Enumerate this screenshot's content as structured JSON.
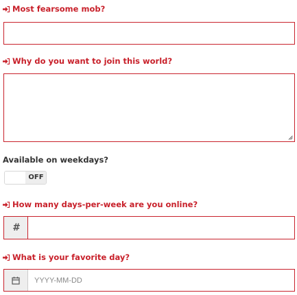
{
  "form": {
    "mob_label": "Most fearsome mob?",
    "why_label": "Why do you want to join this world?",
    "weekdays_label": "Available on weekdays?",
    "weekdays_toggle": "OFF",
    "days_label": "How many days-per-week are you online?",
    "days_addon": "#",
    "day_label": "What is your favorite day?",
    "day_placeholder": "YYYY-MM-DD"
  },
  "icons": {
    "required": "sign-in-icon",
    "date": "calendar-icon",
    "resize": "resize-grip-icon"
  },
  "colors": {
    "error": "#c8202a",
    "addon_bg": "#eeeeee"
  }
}
